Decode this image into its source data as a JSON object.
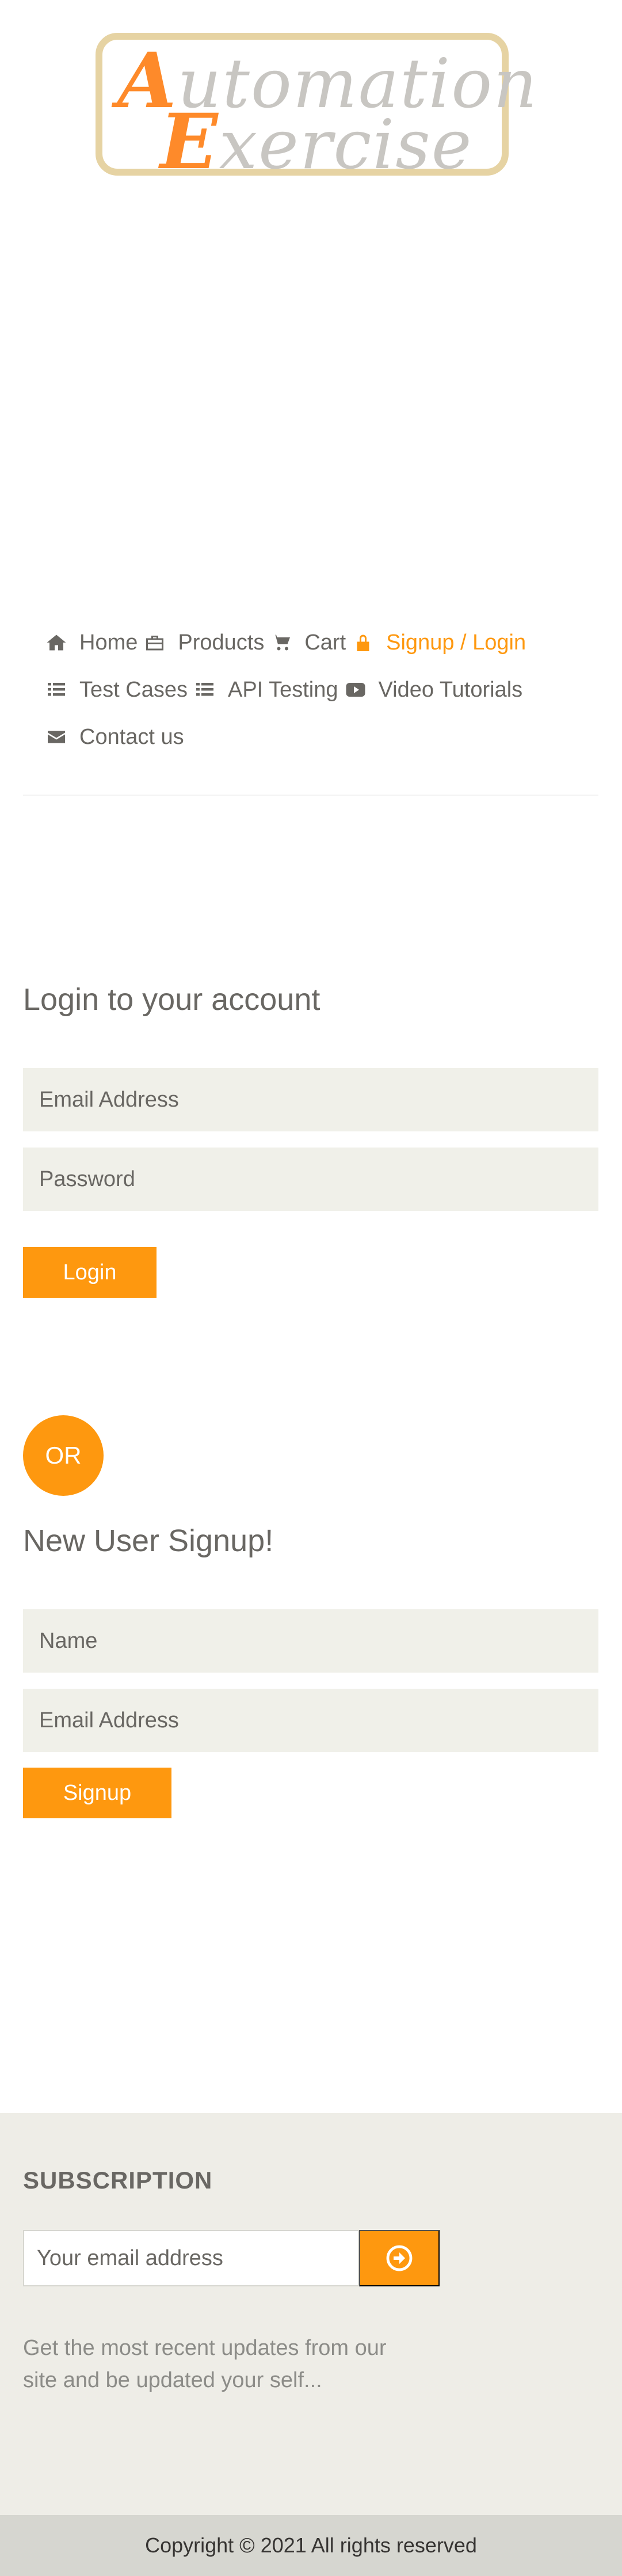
{
  "logo": {
    "line1_cap": "A",
    "line1_rest": "utomation",
    "line2_cap": "E",
    "line2_rest": "xercise"
  },
  "nav": {
    "items": [
      {
        "label": "Home",
        "icon": "home-icon"
      },
      {
        "label": "Products",
        "icon": "briefcase-icon"
      },
      {
        "label": "Cart",
        "icon": "cart-icon"
      },
      {
        "label": "Signup / Login",
        "icon": "lock-icon",
        "active": true
      },
      {
        "label": "Test Cases",
        "icon": "list-icon"
      },
      {
        "label": "API Testing",
        "icon": "list-icon"
      },
      {
        "label": "Video Tutorials",
        "icon": "youtube-play-icon"
      },
      {
        "label": "Contact us",
        "icon": "envelope-icon"
      }
    ]
  },
  "login": {
    "title": "Login to your account",
    "email_placeholder": "Email Address",
    "password_placeholder": "Password",
    "button": "Login"
  },
  "or_label": "OR",
  "signup": {
    "title": "New User Signup!",
    "name_placeholder": "Name",
    "email_placeholder": "Email Address",
    "button": "Signup"
  },
  "footer": {
    "subscription_title": "SUBSCRIPTION",
    "email_placeholder": "Your email address",
    "subscribe_icon": "arrow-circle-right-icon",
    "description": "Get the most recent updates from our site and be updated your self...",
    "copyright": "Copyright © 2021 All rights reserved"
  },
  "colors": {
    "accent": "#fe980f",
    "text": "#696763",
    "input_bg": "#f0f0e9",
    "footer_bg": "#eeede7",
    "footer_bottom_bg": "#d6d6d0"
  }
}
